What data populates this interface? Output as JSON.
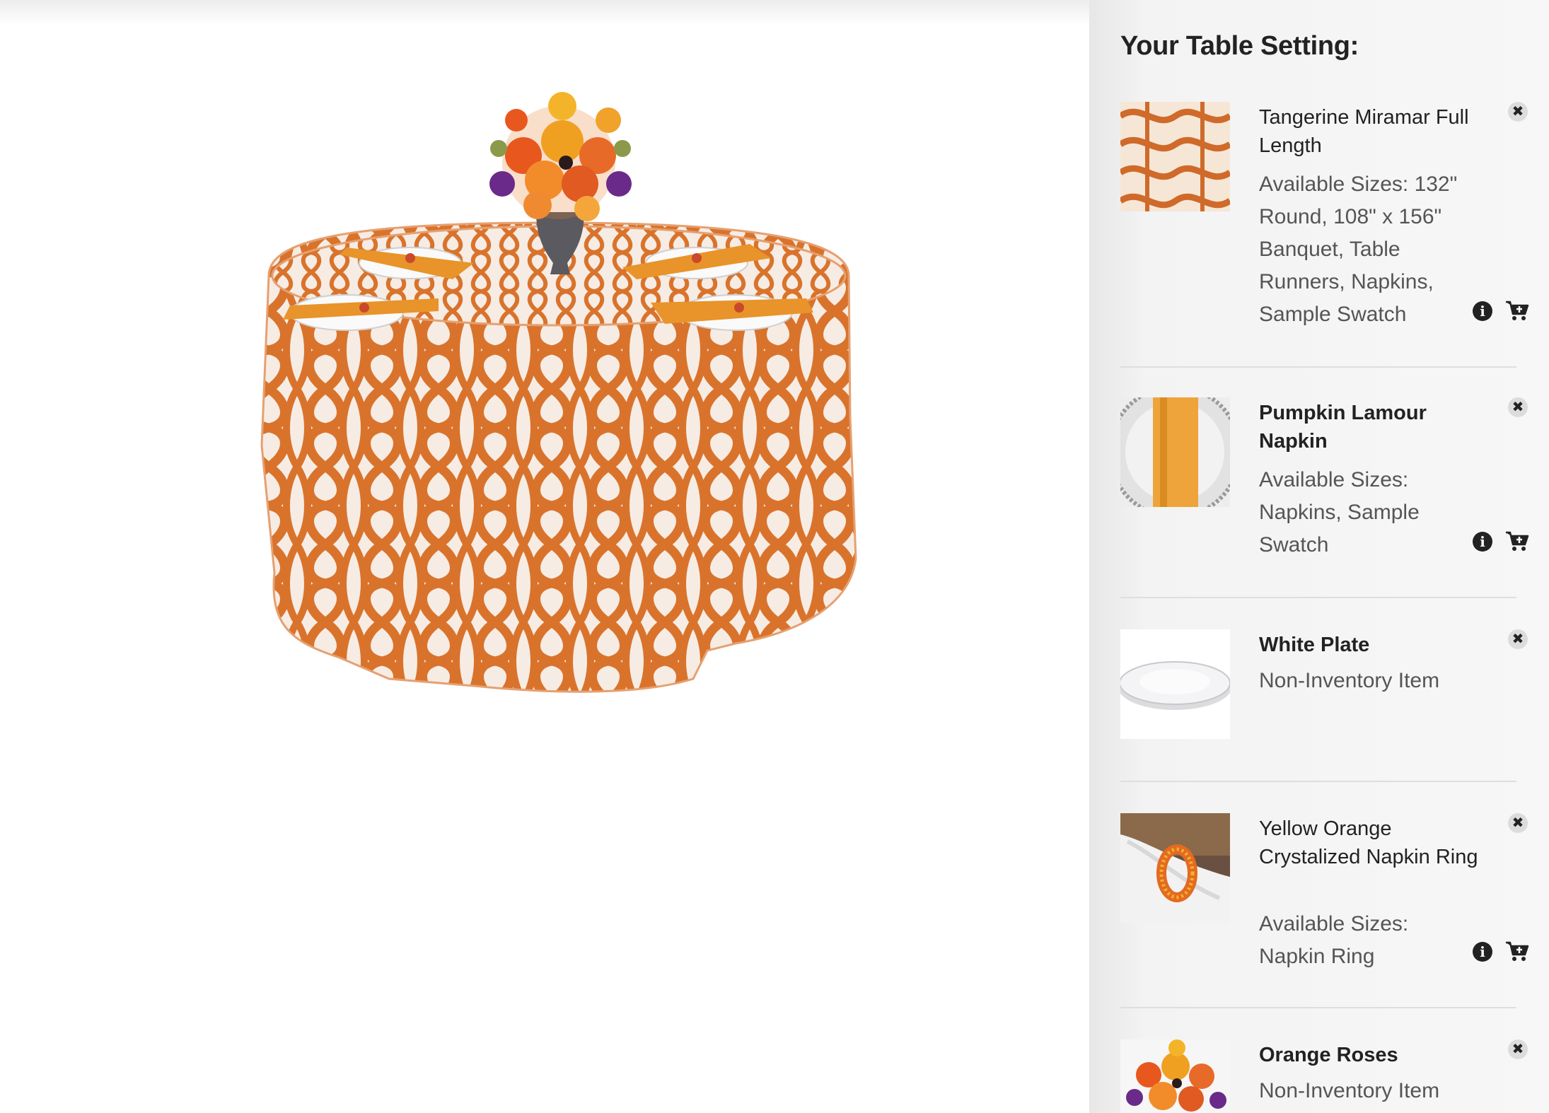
{
  "sidebar": {
    "title": "Your Table Setting:",
    "items": [
      {
        "name": "Tangerine Miramar Full Length",
        "sizes": "Available Sizes: 132\" Round, 108\" x 156\" Banquet, Table Runners, Napkins, Sample Swatch",
        "thumb_icon": "miramar-fabric-swatch"
      },
      {
        "name": "Pumpkin Lamour Napkin",
        "sizes": "Available Sizes: Napkins, Sample Swatch",
        "thumb_icon": "pumpkin-napkin-on-charger"
      },
      {
        "name": "White Plate",
        "sizes": "Non-Inventory Item",
        "thumb_icon": "white-plate"
      },
      {
        "name": "Yellow Orange Crystalized Napkin Ring",
        "sizes": "Available Sizes: Napkin Ring",
        "thumb_icon": "napkin-ring"
      },
      {
        "name": "Orange Roses",
        "sizes": "Non-Inventory Item",
        "thumb_icon": "orange-roses-centerpiece"
      }
    ]
  },
  "colors": {
    "tablecloth_orange": "#d9732c",
    "tablecloth_white": "#f6ece4",
    "napkin": "#e8942a",
    "sidebar_bg": "#f3f3f3"
  },
  "icons": {
    "close": "close-icon",
    "info": "info-icon",
    "cart": "add-to-cart-icon"
  }
}
